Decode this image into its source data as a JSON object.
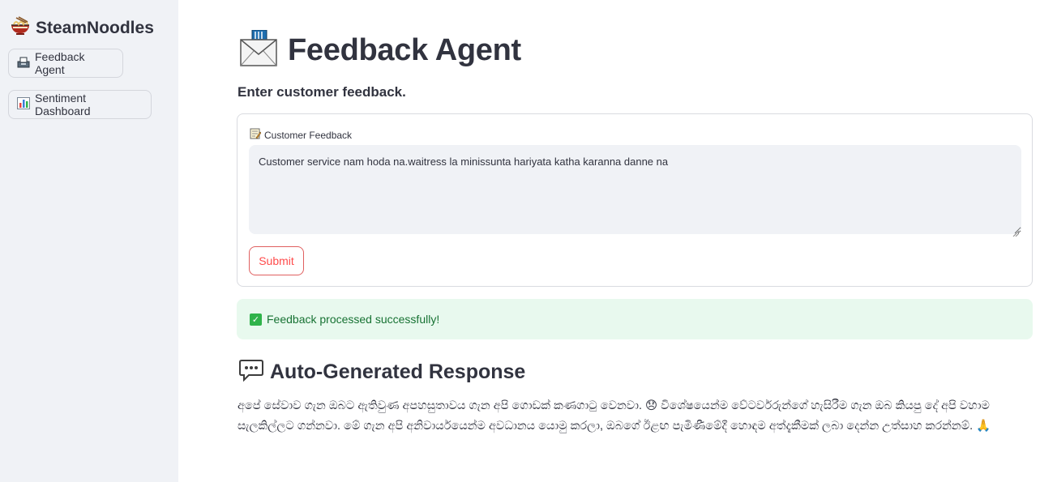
{
  "sidebar": {
    "brand_icon": "noodle-bowl-icon",
    "brand_title": "SteamNoodles",
    "items": [
      {
        "label": "Feedback Agent",
        "icon": "inbox-tray-icon"
      },
      {
        "label": "Sentiment Dashboard",
        "icon": "bar-chart-icon"
      }
    ]
  },
  "main": {
    "title_icon": "mailbox-envelope-icon",
    "title": "Feedback Agent",
    "subtitle": "Enter customer feedback.",
    "form": {
      "field_icon": "memo-icon",
      "field_label": "Customer Feedback",
      "field_value": "Customer service nam hoda na.waitress la minissunta hariyata katha karanna danne na",
      "submit_label": "Submit"
    },
    "success_message": "Feedback processed successfully!",
    "response": {
      "icon": "speech-bubble-icon",
      "title": "Auto-Generated Response",
      "text": "අපේ සේවාව ගැන ඔබට ඇතිවුණ අපහසුතාවය ගැන අපි ගොඩක් කණගාටු වෙනවා. 😞 විශේෂයෙන්ම වේටර්වරුන්ගේ හැසිරීම ගැන ඔබ කියපු දේ අපි වහාම සැලකිල්ලට ගන්නවා. මේ ගැන අපි අනිවාර්යයෙන්ම අවධානය යොමු කරලා, ඔබගේ ඊළඟ පැමිණීමේදී හොඳම අත්දැකීමක් ලබා දෙන්න උත්සාහ කරන්නම්. 🙏"
    }
  },
  "colors": {
    "sidebar_bg": "#f0f2f6",
    "accent_red": "#ff4b4b",
    "success_bg": "#e8f9ee",
    "success_text": "#177233"
  }
}
